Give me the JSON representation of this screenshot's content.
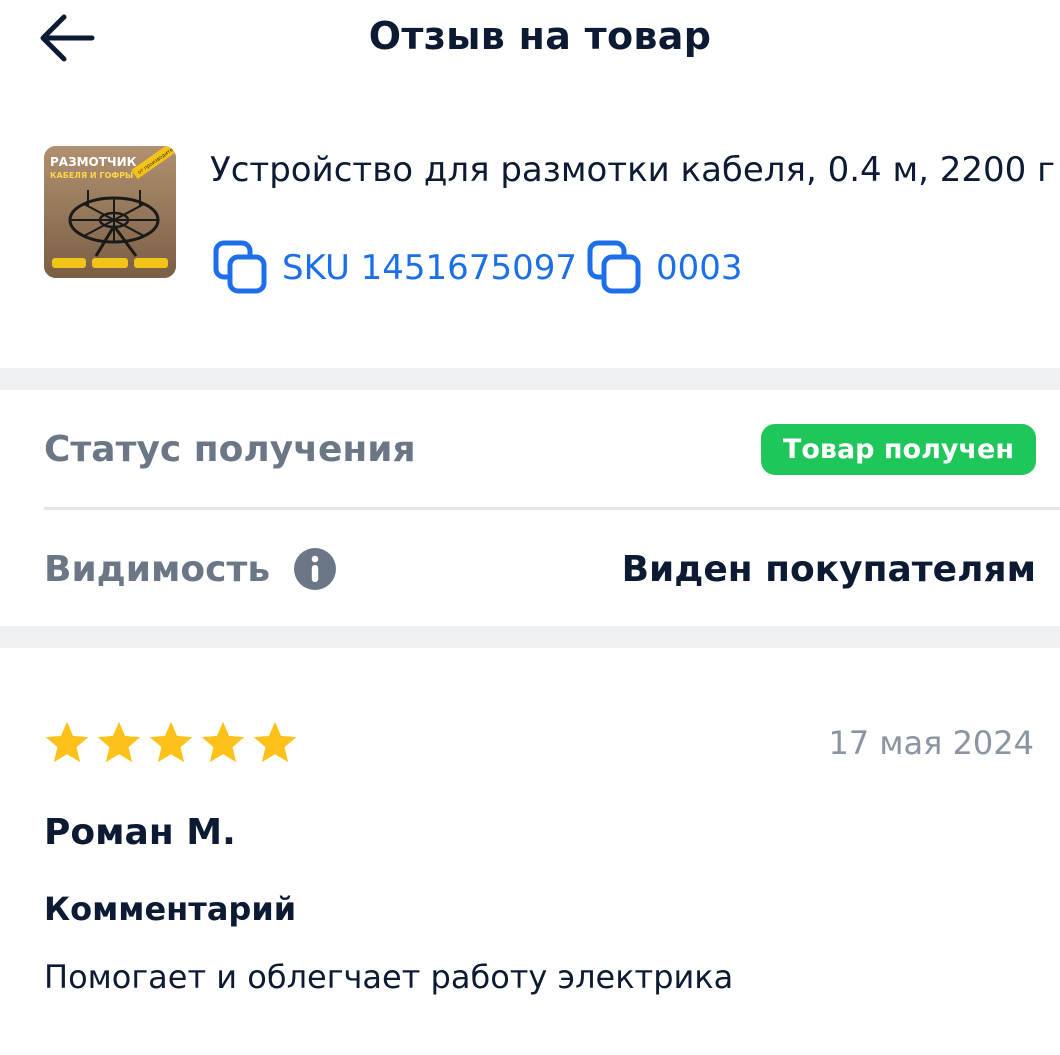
{
  "header": {
    "title": "Отзыв на товар",
    "back_icon": "arrow-left-icon"
  },
  "product": {
    "name": "Устройство для размотки кабеля, 0.4 м, 2200 г",
    "sku_label": "SKU 1451675097",
    "code_label": "0003",
    "copy_icon": "copy-icon",
    "thumbnail": {
      "title_line1": "РАЗМОТЧИК",
      "title_line2": "КАБЕЛЯ И ГОФРЫ",
      "ribbon": "от производителя"
    }
  },
  "status": {
    "label": "Статус получения",
    "badge": "Товар получен",
    "badge_color": "#1fc65a"
  },
  "visibility": {
    "label": "Видимость",
    "value": "Виден покупателям",
    "info_icon": "info-icon"
  },
  "review": {
    "rating": 5,
    "max_rating": 5,
    "star_color": "#fcc21b",
    "date": "17 мая 2024",
    "author": "Роман М.",
    "comment_label": "Комментарий",
    "comment": "Помогает и облегчает работу электрика"
  },
  "colors": {
    "accent": "#1c6fe8",
    "text": "#0c1b33",
    "muted": "#6b7786"
  }
}
